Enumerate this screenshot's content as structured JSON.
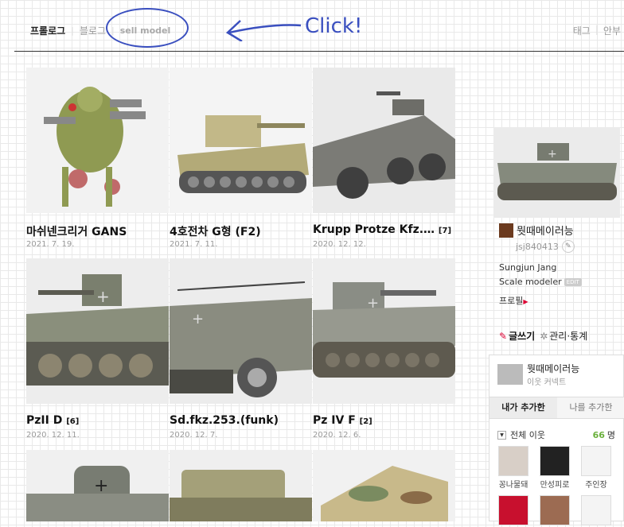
{
  "nav": {
    "left": [
      "프롤로그",
      "블로그",
      "sell model"
    ],
    "right": [
      "태그",
      "안부"
    ]
  },
  "annotation": {
    "click_label": "Click!"
  },
  "posts": [
    {
      "title": "마쉬넨크리거 GANS",
      "count": "",
      "date": "2021. 7. 19."
    },
    {
      "title": "4호전차 G형 (F2)",
      "count": "",
      "date": "2021. 7. 11."
    },
    {
      "title": "Krupp Protze Kfz.…",
      "count": "[7]",
      "date": "2020. 12. 12."
    },
    {
      "title": "PzII D",
      "count": "[6]",
      "date": "2020. 12. 11."
    },
    {
      "title": "Sd.fkz.253.(funk)",
      "count": "",
      "date": "2020. 12. 7."
    },
    {
      "title": "Pz IV F",
      "count": "[2]",
      "date": "2020. 12. 6."
    }
  ],
  "profile": {
    "blog_name": "뭣때메이러능",
    "user_id": "jsj840413",
    "name_line": "Sungjun Jang",
    "role_line": "Scale modeler",
    "edit_badge": "EDIT",
    "profile_link": "프로필",
    "write_label": "글쓰기",
    "manage_label": "관리·통계"
  },
  "neighbors": {
    "title": "뭣때메이러능",
    "subtitle": "이웃 커넥트",
    "tabs": [
      "내가 추가한",
      "나를 추가한"
    ],
    "filter_label": "전체 이웃",
    "count": "66",
    "count_unit": "명",
    "friends": [
      "꽁나물돼",
      "만성피로",
      "주인장"
    ]
  },
  "colors": {
    "annotation": "#3a4fbf",
    "count_green": "#6ab03c",
    "accent_red": "#dd0033"
  }
}
